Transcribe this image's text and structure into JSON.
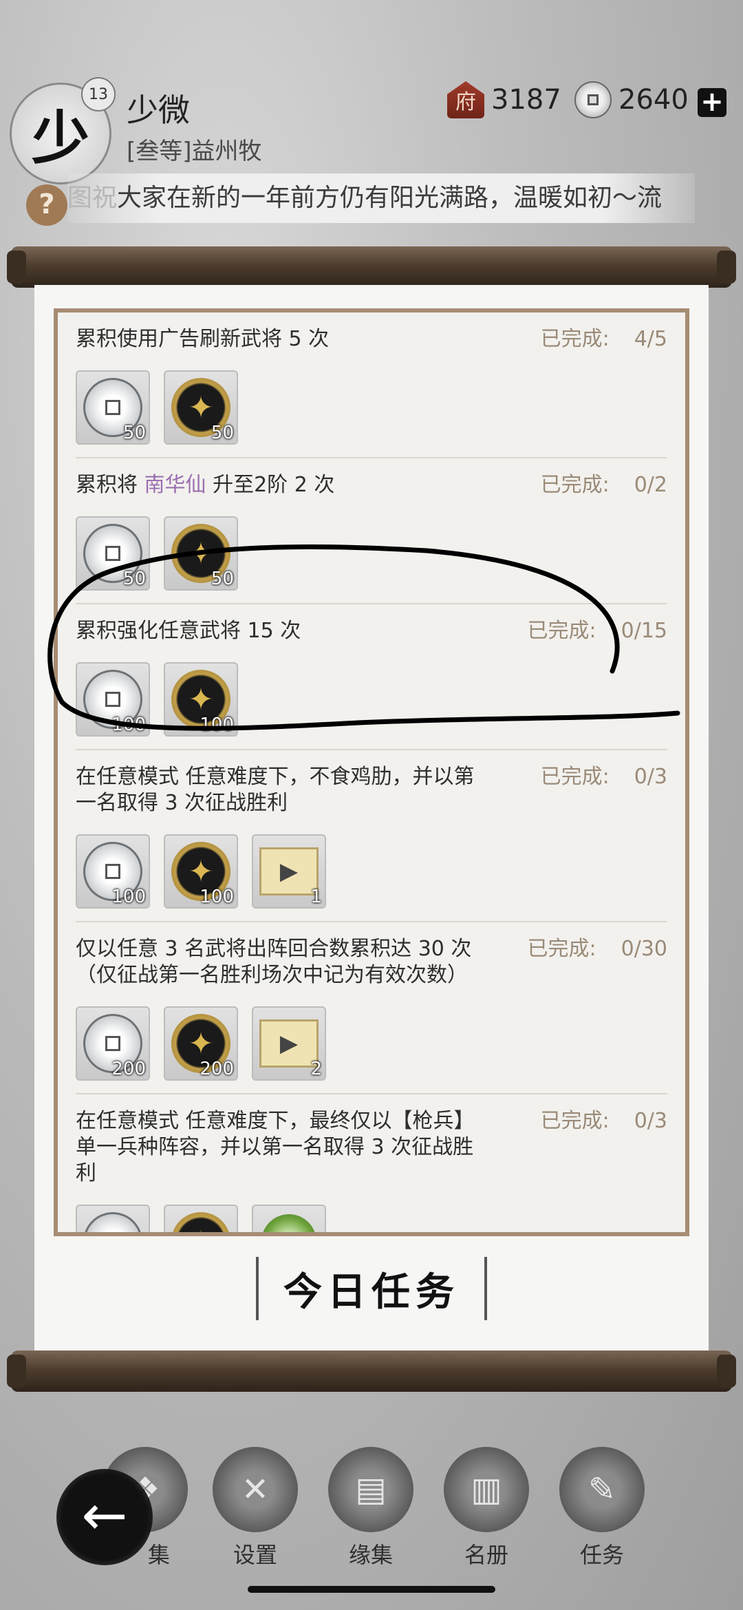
{
  "header": {
    "avatar_glyph": "少",
    "level": "13",
    "name": "少微",
    "title": "[叁等]益州牧",
    "currency_a": "3187",
    "currency_b": "2640",
    "plus": "+",
    "help": "?",
    "marquee_dim": "图祝",
    "marquee_text": "大家在新的一年前方仍有阳光满路，温暖如初～流"
  },
  "status_label": "已完成:",
  "tasks": [
    {
      "desc": "累积使用广告刷新武将 5 次",
      "progress": "4/5",
      "rewards": [
        {
          "icon": "silver-coin-icon",
          "amount": "50"
        },
        {
          "icon": "gold-coin-icon",
          "amount": "50"
        }
      ]
    },
    {
      "desc_pre": "累积将 ",
      "desc_highlight": "南华仙",
      "desc_post": " 升至2阶 2 次",
      "progress": "0/2",
      "rewards": [
        {
          "icon": "silver-coin-icon",
          "amount": "50"
        },
        {
          "icon": "gold-coin-icon",
          "amount": "50"
        }
      ]
    },
    {
      "desc": "累积强化任意武将 15 次",
      "progress": "0/15",
      "rewards": [
        {
          "icon": "silver-coin-icon",
          "amount": "100"
        },
        {
          "icon": "gold-coin-icon",
          "amount": "100"
        }
      ]
    },
    {
      "desc": "在任意模式 任意难度下，不食鸡肋，并以第一名取得 3 次征战胜利",
      "progress": "0/3",
      "rewards": [
        {
          "icon": "silver-coin-icon",
          "amount": "100"
        },
        {
          "icon": "gold-coin-icon",
          "amount": "100"
        },
        {
          "icon": "ticket-icon",
          "amount": "1"
        }
      ]
    },
    {
      "desc": "仅以任意 3 名武将出阵回合数累积达 30 次（仅征战第一名胜利场次中记为有效次数）",
      "progress": "0/30",
      "rewards": [
        {
          "icon": "silver-coin-icon",
          "amount": "200"
        },
        {
          "icon": "gold-coin-icon",
          "amount": "200"
        },
        {
          "icon": "ticket-icon",
          "amount": "2"
        }
      ]
    },
    {
      "desc": "在任意模式 任意难度下，最终仅以【枪兵】单一兵种阵容，并以第一名取得 3 次征战胜利",
      "progress": "0/3",
      "rewards": [
        {
          "icon": "silver-coin-icon",
          "amount": ""
        },
        {
          "icon": "gold-coin-icon",
          "amount": ""
        },
        {
          "icon": "green-disc-icon",
          "amount": ""
        }
      ]
    }
  ],
  "tab_label": "今日任务",
  "nav": {
    "back_glyph": "←",
    "items": [
      {
        "label": "集"
      },
      {
        "label": "设置"
      },
      {
        "label": "缘集"
      },
      {
        "label": "名册"
      },
      {
        "label": "任务"
      }
    ]
  },
  "colors": {
    "accent_purple": "#9b6fb0",
    "frame_brown": "#a68c74",
    "status_text": "#9a8a77"
  }
}
